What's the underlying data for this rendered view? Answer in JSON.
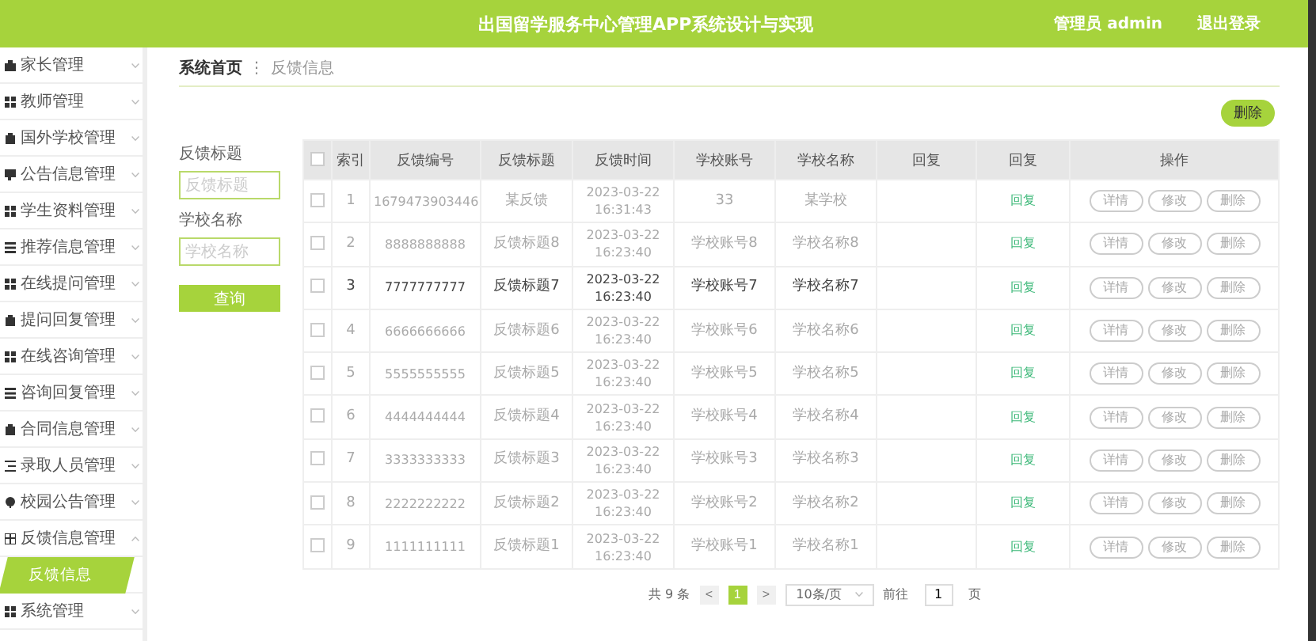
{
  "header": {
    "title": "出国留学服务中心管理APP系统设计与实现",
    "user": "管理员 admin",
    "logout": "退出登录"
  },
  "sidebar": {
    "items": [
      {
        "label": "家长管理",
        "kind": "case",
        "expanded": false
      },
      {
        "label": "教师管理",
        "kind": "grid",
        "expanded": false
      },
      {
        "label": "国外学校管理",
        "kind": "bag",
        "expanded": false
      },
      {
        "label": "公告信息管理",
        "kind": "chat",
        "expanded": false
      },
      {
        "label": "学生资料管理",
        "kind": "grid",
        "expanded": false
      },
      {
        "label": "推荐信息管理",
        "kind": "list",
        "expanded": false
      },
      {
        "label": "在线提问管理",
        "kind": "grid",
        "expanded": false
      },
      {
        "label": "提问回复管理",
        "kind": "bag",
        "expanded": false
      },
      {
        "label": "在线咨询管理",
        "kind": "grid",
        "expanded": false
      },
      {
        "label": "咨询回复管理",
        "kind": "list",
        "expanded": false
      },
      {
        "label": "合同信息管理",
        "kind": "bag",
        "expanded": false
      },
      {
        "label": "录取人员管理",
        "kind": "lines",
        "expanded": false
      },
      {
        "label": "校园公告管理",
        "kind": "pin",
        "expanded": false
      },
      {
        "label": "反馈信息管理",
        "kind": "table",
        "expanded": true,
        "children": [
          {
            "label": "反馈信息",
            "selected": true
          }
        ]
      },
      {
        "label": "系统管理",
        "kind": "grid",
        "expanded": false
      }
    ]
  },
  "breadcrumb": {
    "home": "系统首页",
    "separator": "⋮",
    "current": "反馈信息"
  },
  "search": {
    "fields": [
      {
        "label": "反馈标题",
        "placeholder": "反馈标题"
      },
      {
        "label": "学校名称",
        "placeholder": "学校名称"
      }
    ],
    "button": "查询"
  },
  "delete_button": "删除",
  "table": {
    "select_all": {
      "checked": false
    },
    "columns": [
      "索引",
      "反馈编号",
      "反馈标题",
      "反馈时间",
      "学校账号",
      "学校名称",
      "回复",
      "回复",
      "操作"
    ],
    "rows": [
      {
        "cells": [
          "1",
          "1679473903446",
          "某反馈",
          "2023-03-22 16:31:43",
          "33",
          "某学校"
        ],
        "link": "回复",
        "actions": [
          "详情",
          "修改",
          "删除"
        ],
        "checked": false,
        "hovered": false
      },
      {
        "cells": [
          "2",
          "8888888888",
          "反馈标题8",
          "2023-03-22 16:23:40",
          "学校账号8",
          "学校名称8"
        ],
        "link": "回复",
        "actions": [
          "详情",
          "修改",
          "删除"
        ],
        "checked": false,
        "hovered": false
      },
      {
        "cells": [
          "3",
          "7777777777",
          "反馈标题7",
          "2023-03-22 16:23:40",
          "学校账号7",
          "学校名称7"
        ],
        "link": "回复",
        "actions": [
          "详情",
          "修改",
          "删除"
        ],
        "checked": false,
        "hovered": true
      },
      {
        "cells": [
          "4",
          "6666666666",
          "反馈标题6",
          "2023-03-22 16:23:40",
          "学校账号6",
          "学校名称6"
        ],
        "link": "回复",
        "actions": [
          "详情",
          "修改",
          "删除"
        ],
        "checked": false,
        "hovered": false
      },
      {
        "cells": [
          "5",
          "5555555555",
          "反馈标题5",
          "2023-03-22 16:23:40",
          "学校账号5",
          "学校名称5"
        ],
        "link": "回复",
        "actions": [
          "详情",
          "修改",
          "删除"
        ],
        "checked": false,
        "hovered": false
      },
      {
        "cells": [
          "6",
          "4444444444",
          "反馈标题4",
          "2023-03-22 16:23:40",
          "学校账号4",
          "学校名称4"
        ],
        "link": "回复",
        "actions": [
          "详情",
          "修改",
          "删除"
        ],
        "checked": false,
        "hovered": false
      },
      {
        "cells": [
          "7",
          "3333333333",
          "反馈标题3",
          "2023-03-22 16:23:40",
          "学校账号3",
          "学校名称3"
        ],
        "link": "回复",
        "actions": [
          "详情",
          "修改",
          "删除"
        ],
        "checked": false,
        "hovered": false
      },
      {
        "cells": [
          "8",
          "2222222222",
          "反馈标题2",
          "2023-03-22 16:23:40",
          "学校账号2",
          "学校名称2"
        ],
        "link": "回复",
        "actions": [
          "详情",
          "修改",
          "删除"
        ],
        "checked": false,
        "hovered": false
      },
      {
        "cells": [
          "9",
          "1111111111",
          "反馈标题1",
          "2023-03-22 16:23:40",
          "学校账号1",
          "学校名称1"
        ],
        "link": "回复",
        "actions": [
          "详情",
          "修改",
          "删除"
        ],
        "checked": false,
        "hovered": false
      }
    ]
  },
  "pagination": {
    "total": "共 9 条",
    "prev": "<",
    "pages": [
      {
        "label": "1",
        "selected": true
      }
    ],
    "next": ">",
    "page_size": "10条/页",
    "goto_label": "前往",
    "goto_value": "1",
    "goto_suffix": "页"
  }
}
